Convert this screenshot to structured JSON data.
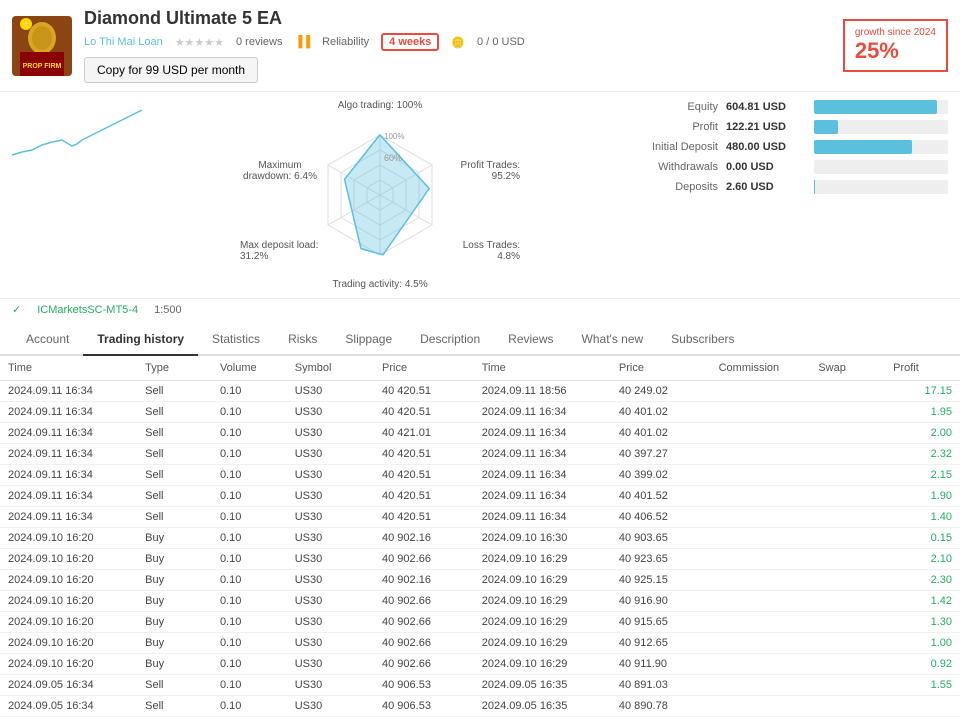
{
  "header": {
    "title": "Diamond Ultimate 5 EA",
    "author": "Lo Thi Mai Loan",
    "reviews": "0 reviews",
    "reliability": "Reliability",
    "weeks": "4 weeks",
    "usd": "0 / 0 USD",
    "copy_btn": "Copy for 99 USD per month",
    "growth_since": "growth since 2024",
    "growth_pct": "25%"
  },
  "stats": {
    "equity_label": "Equity",
    "equity_value": "604.81 USD",
    "equity_bar_pct": 92,
    "profit_label": "Profit",
    "profit_value": "122.21 USD",
    "profit_bar_pct": 18,
    "initial_deposit_label": "Initial Deposit",
    "initial_deposit_value": "480.00 USD",
    "initial_deposit_bar_pct": 73,
    "withdrawals_label": "Withdrawals",
    "withdrawals_value": "0.00 USD",
    "withdrawals_bar_pct": 0,
    "deposits_label": "Deposits",
    "deposits_value": "2.60 USD",
    "deposits_bar_pct": 1
  },
  "radar": {
    "algo_trading_label": "Algo trading: 100%",
    "maximum_drawdown_label": "Maximum drawdown: 6.4%",
    "max_deposit_load_label": "Max deposit load: 31.2%",
    "profit_trades_label": "Profit Trades: 95.2%",
    "loss_trades_label": "Loss Trades: 4.8%",
    "trading_activity_label": "Trading activity: 4.5%",
    "center_label": "60%"
  },
  "broker": {
    "name": "ICMarketsSC-MT5-4",
    "leverage": "1:500"
  },
  "tabs": [
    "Account",
    "Trading history",
    "Statistics",
    "Risks",
    "Slippage",
    "Description",
    "Reviews",
    "What's new",
    "Subscribers"
  ],
  "active_tab": "Trading history",
  "table": {
    "columns": [
      "Time",
      "Type",
      "Volume",
      "Symbol",
      "Price",
      "Time",
      "Price",
      "Commission",
      "Swap",
      "Profit"
    ],
    "rows": [
      [
        "2024.09.11 16:34",
        "Sell",
        "0.10",
        "US30",
        "40 420.51",
        "2024.09.11 18:56",
        "40 249.02",
        "",
        "",
        "17.15"
      ],
      [
        "2024.09.11 16:34",
        "Sell",
        "0.10",
        "US30",
        "40 420.51",
        "2024.09.11 16:34",
        "40 401.02",
        "",
        "",
        "1.95"
      ],
      [
        "2024.09.11 16:34",
        "Sell",
        "0.10",
        "US30",
        "40 421.01",
        "2024.09.11 16:34",
        "40 401.02",
        "",
        "",
        "2.00"
      ],
      [
        "2024.09.11 16:34",
        "Sell",
        "0.10",
        "US30",
        "40 420.51",
        "2024.09.11 16:34",
        "40 397.27",
        "",
        "",
        "2.32"
      ],
      [
        "2024.09.11 16:34",
        "Sell",
        "0.10",
        "US30",
        "40 420.51",
        "2024.09.11 16:34",
        "40 399.02",
        "",
        "",
        "2.15"
      ],
      [
        "2024.09.11 16:34",
        "Sell",
        "0.10",
        "US30",
        "40 420.51",
        "2024.09.11 16:34",
        "40 401.52",
        "",
        "",
        "1.90"
      ],
      [
        "2024.09.11 16:34",
        "Sell",
        "0.10",
        "US30",
        "40 420.51",
        "2024.09.11 16:34",
        "40 406.52",
        "",
        "",
        "1.40"
      ],
      [
        "2024.09.10 16:20",
        "Buy",
        "0.10",
        "US30",
        "40 902.16",
        "2024.09.10 16:30",
        "40 903.65",
        "",
        "",
        "0.15"
      ],
      [
        "2024.09.10 16:20",
        "Buy",
        "0.10",
        "US30",
        "40 902.66",
        "2024.09.10 16:29",
        "40 923.65",
        "",
        "",
        "2.10"
      ],
      [
        "2024.09.10 16:20",
        "Buy",
        "0.10",
        "US30",
        "40 902.16",
        "2024.09.10 16:29",
        "40 925.15",
        "",
        "",
        "2.30"
      ],
      [
        "2024.09.10 16:20",
        "Buy",
        "0.10",
        "US30",
        "40 902.66",
        "2024.09.10 16:29",
        "40 916.90",
        "",
        "",
        "1.42"
      ],
      [
        "2024.09.10 16:20",
        "Buy",
        "0.10",
        "US30",
        "40 902.66",
        "2024.09.10 16:29",
        "40 915.65",
        "",
        "",
        "1.30"
      ],
      [
        "2024.09.10 16:20",
        "Buy",
        "0.10",
        "US30",
        "40 902.66",
        "2024.09.10 16:29",
        "40 912.65",
        "",
        "",
        "1.00"
      ],
      [
        "2024.09.10 16:20",
        "Buy",
        "0.10",
        "US30",
        "40 902.66",
        "2024.09.10 16:29",
        "40 911.90",
        "",
        "",
        "0.92"
      ],
      [
        "2024.09.05 16:34",
        "Sell",
        "0.10",
        "US30",
        "40 906.53",
        "2024.09.05 16:35",
        "40 891.03",
        "",
        "",
        "1.55"
      ],
      [
        "2024.09.05 16:34",
        "Sell",
        "0.10",
        "US30",
        "40 906.53",
        "2024.09.05 16:35",
        "40 890.78",
        "",
        "",
        ""
      ]
    ]
  }
}
